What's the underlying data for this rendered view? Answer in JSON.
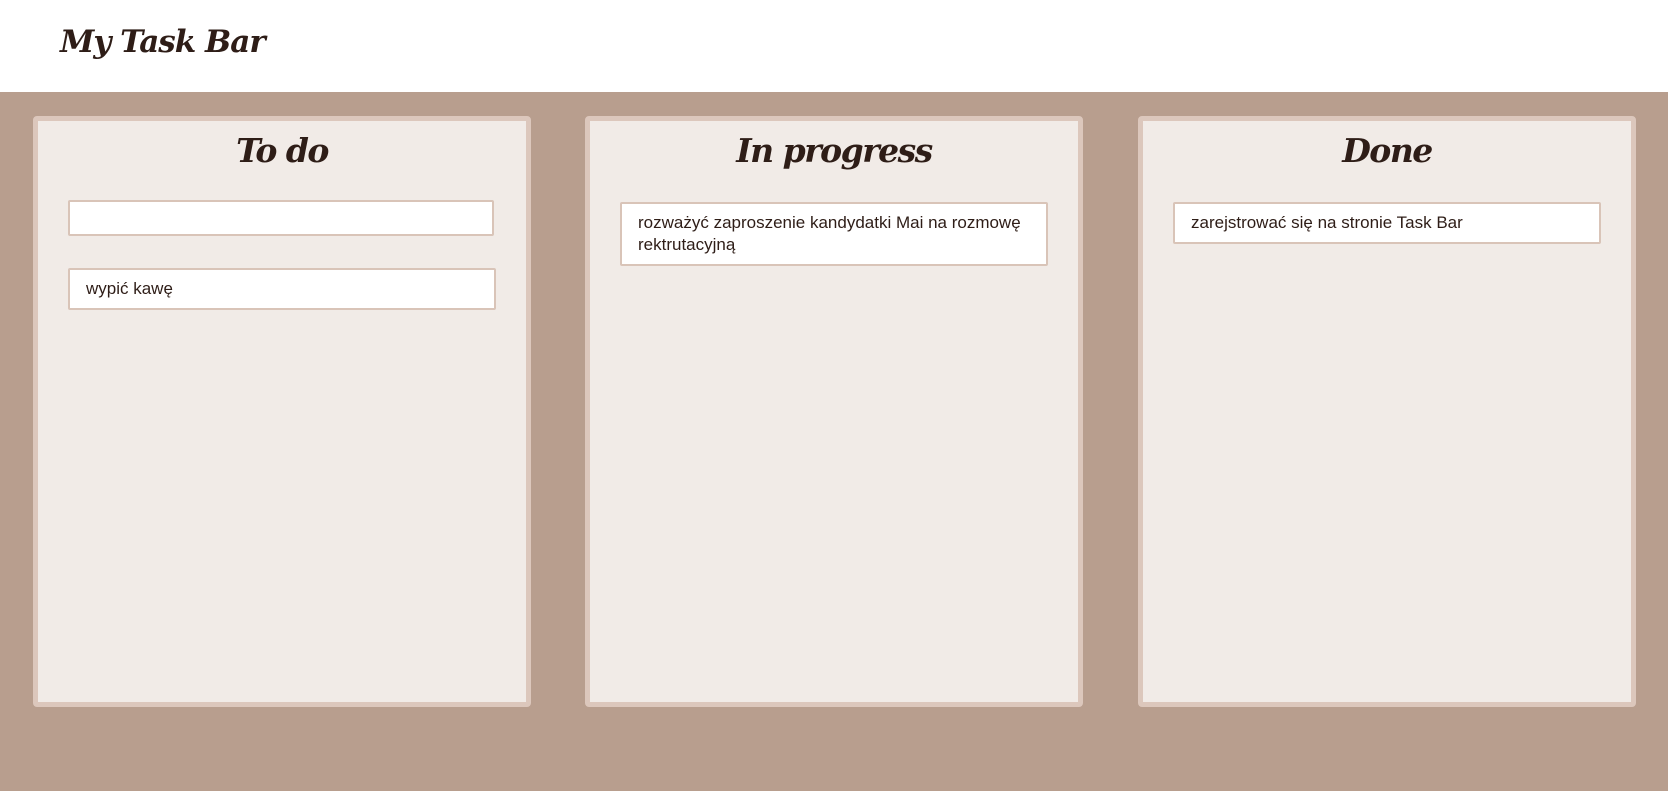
{
  "app": {
    "title": "My Task Bar"
  },
  "columns": [
    {
      "title": "To do",
      "input": {
        "value": "",
        "placeholder": ""
      },
      "tasks": [
        "wypić kawę"
      ]
    },
    {
      "title": "In progress",
      "tasks": [
        "rozważyć zaproszenie kandydatki Mai na rozmowę rektrutacyjną"
      ]
    },
    {
      "title": "Done",
      "tasks": [
        "zarejstrować się na stronie Task Bar"
      ]
    }
  ],
  "colors": {
    "header_background": "#ffffff",
    "page_background": "#b89e8e",
    "column_background": "#f1ebe7",
    "column_border": "#dcc7bc",
    "card_border": "#d9c4b8",
    "text": "#2e1d17"
  }
}
